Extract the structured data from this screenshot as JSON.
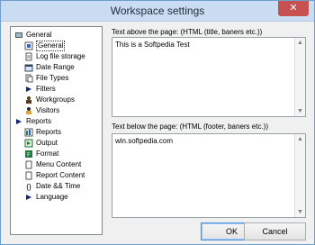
{
  "window": {
    "title": "Workspace settings",
    "close_symbol": "✕"
  },
  "tree": {
    "items": [
      {
        "label": "General",
        "icon": "general-folder-icon"
      },
      {
        "label": "General",
        "icon": "settings-icon"
      },
      {
        "label": "Log file storage",
        "icon": "log-file-storage-icon"
      },
      {
        "label": "Date Range",
        "icon": "date-range-icon"
      },
      {
        "label": "File Types",
        "icon": "file-types-icon"
      },
      {
        "label": "Filters",
        "icon": "filter-arrow-icon"
      },
      {
        "label": "Workgroups",
        "icon": "workgroups-icon"
      },
      {
        "label": "Visitors",
        "icon": "visitors-icon"
      },
      {
        "label": "Reports",
        "icon": "reports-arrow-icon"
      },
      {
        "label": "Reports",
        "icon": "reports-icon"
      },
      {
        "label": "Output",
        "icon": "output-icon"
      },
      {
        "label": "Format",
        "icon": "format-icon"
      },
      {
        "label": "Menu Content",
        "icon": "menu-content-icon"
      },
      {
        "label": "Report Content",
        "icon": "report-content-icon"
      },
      {
        "label": "Date && Time",
        "icon": "braces-icon"
      },
      {
        "label": "Language",
        "icon": "language-arrow-icon"
      }
    ]
  },
  "main": {
    "above_label": "Text above the page: (HTML (title, baners etc.))",
    "above_value": "This is a Softpedia Test",
    "below_label": "Text below the page: (HTML (footer, baners etc.))",
    "below_value": "win.softpedia.com"
  },
  "buttons": {
    "ok": "OK",
    "cancel": "Cancel"
  },
  "colors": {
    "titlebar": "#c9dcf1",
    "close": "#c75050",
    "selected_border": "#333333"
  }
}
